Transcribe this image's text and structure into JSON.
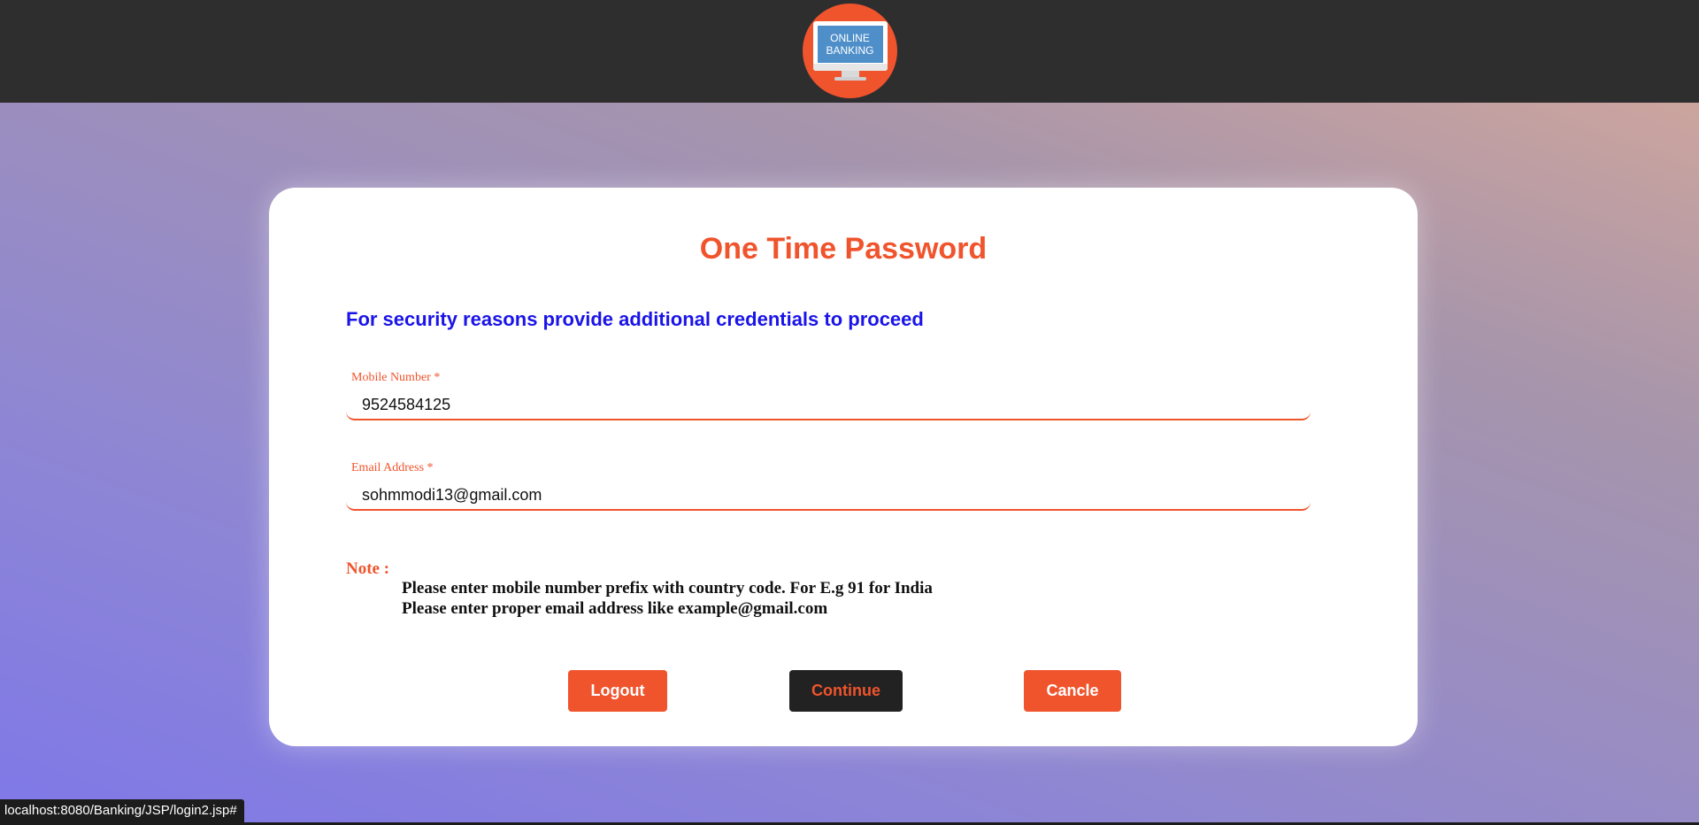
{
  "header": {
    "logo": {
      "line1": "ONLINE",
      "line2": "BANKING",
      "icon": "monitor-icon",
      "color": "#f0542d"
    }
  },
  "form": {
    "title": "One Time Password",
    "subtitle": "For security reasons provide additional credentials to proceed",
    "mobile": {
      "label": "Mobile Number *",
      "value": "9524584125"
    },
    "email": {
      "label": "Email Address *",
      "value": "sohmmodi13@gmail.com"
    },
    "note": {
      "title": "Note :",
      "lines": [
        "Please enter mobile number prefix with country code. For E.g 91 for India",
        "Please enter proper email address like example@gmail.com"
      ]
    },
    "buttons": {
      "logout": "Logout",
      "continue": "Continue",
      "cancel": "Cancle"
    }
  },
  "statusbar": {
    "url": "localhost:8080/Banking/JSP/login2.jsp#"
  },
  "colors": {
    "accent": "#f0542d",
    "subtitle": "#1a14e8",
    "topbar": "#2e2e2e",
    "dark_button": "#222222"
  }
}
